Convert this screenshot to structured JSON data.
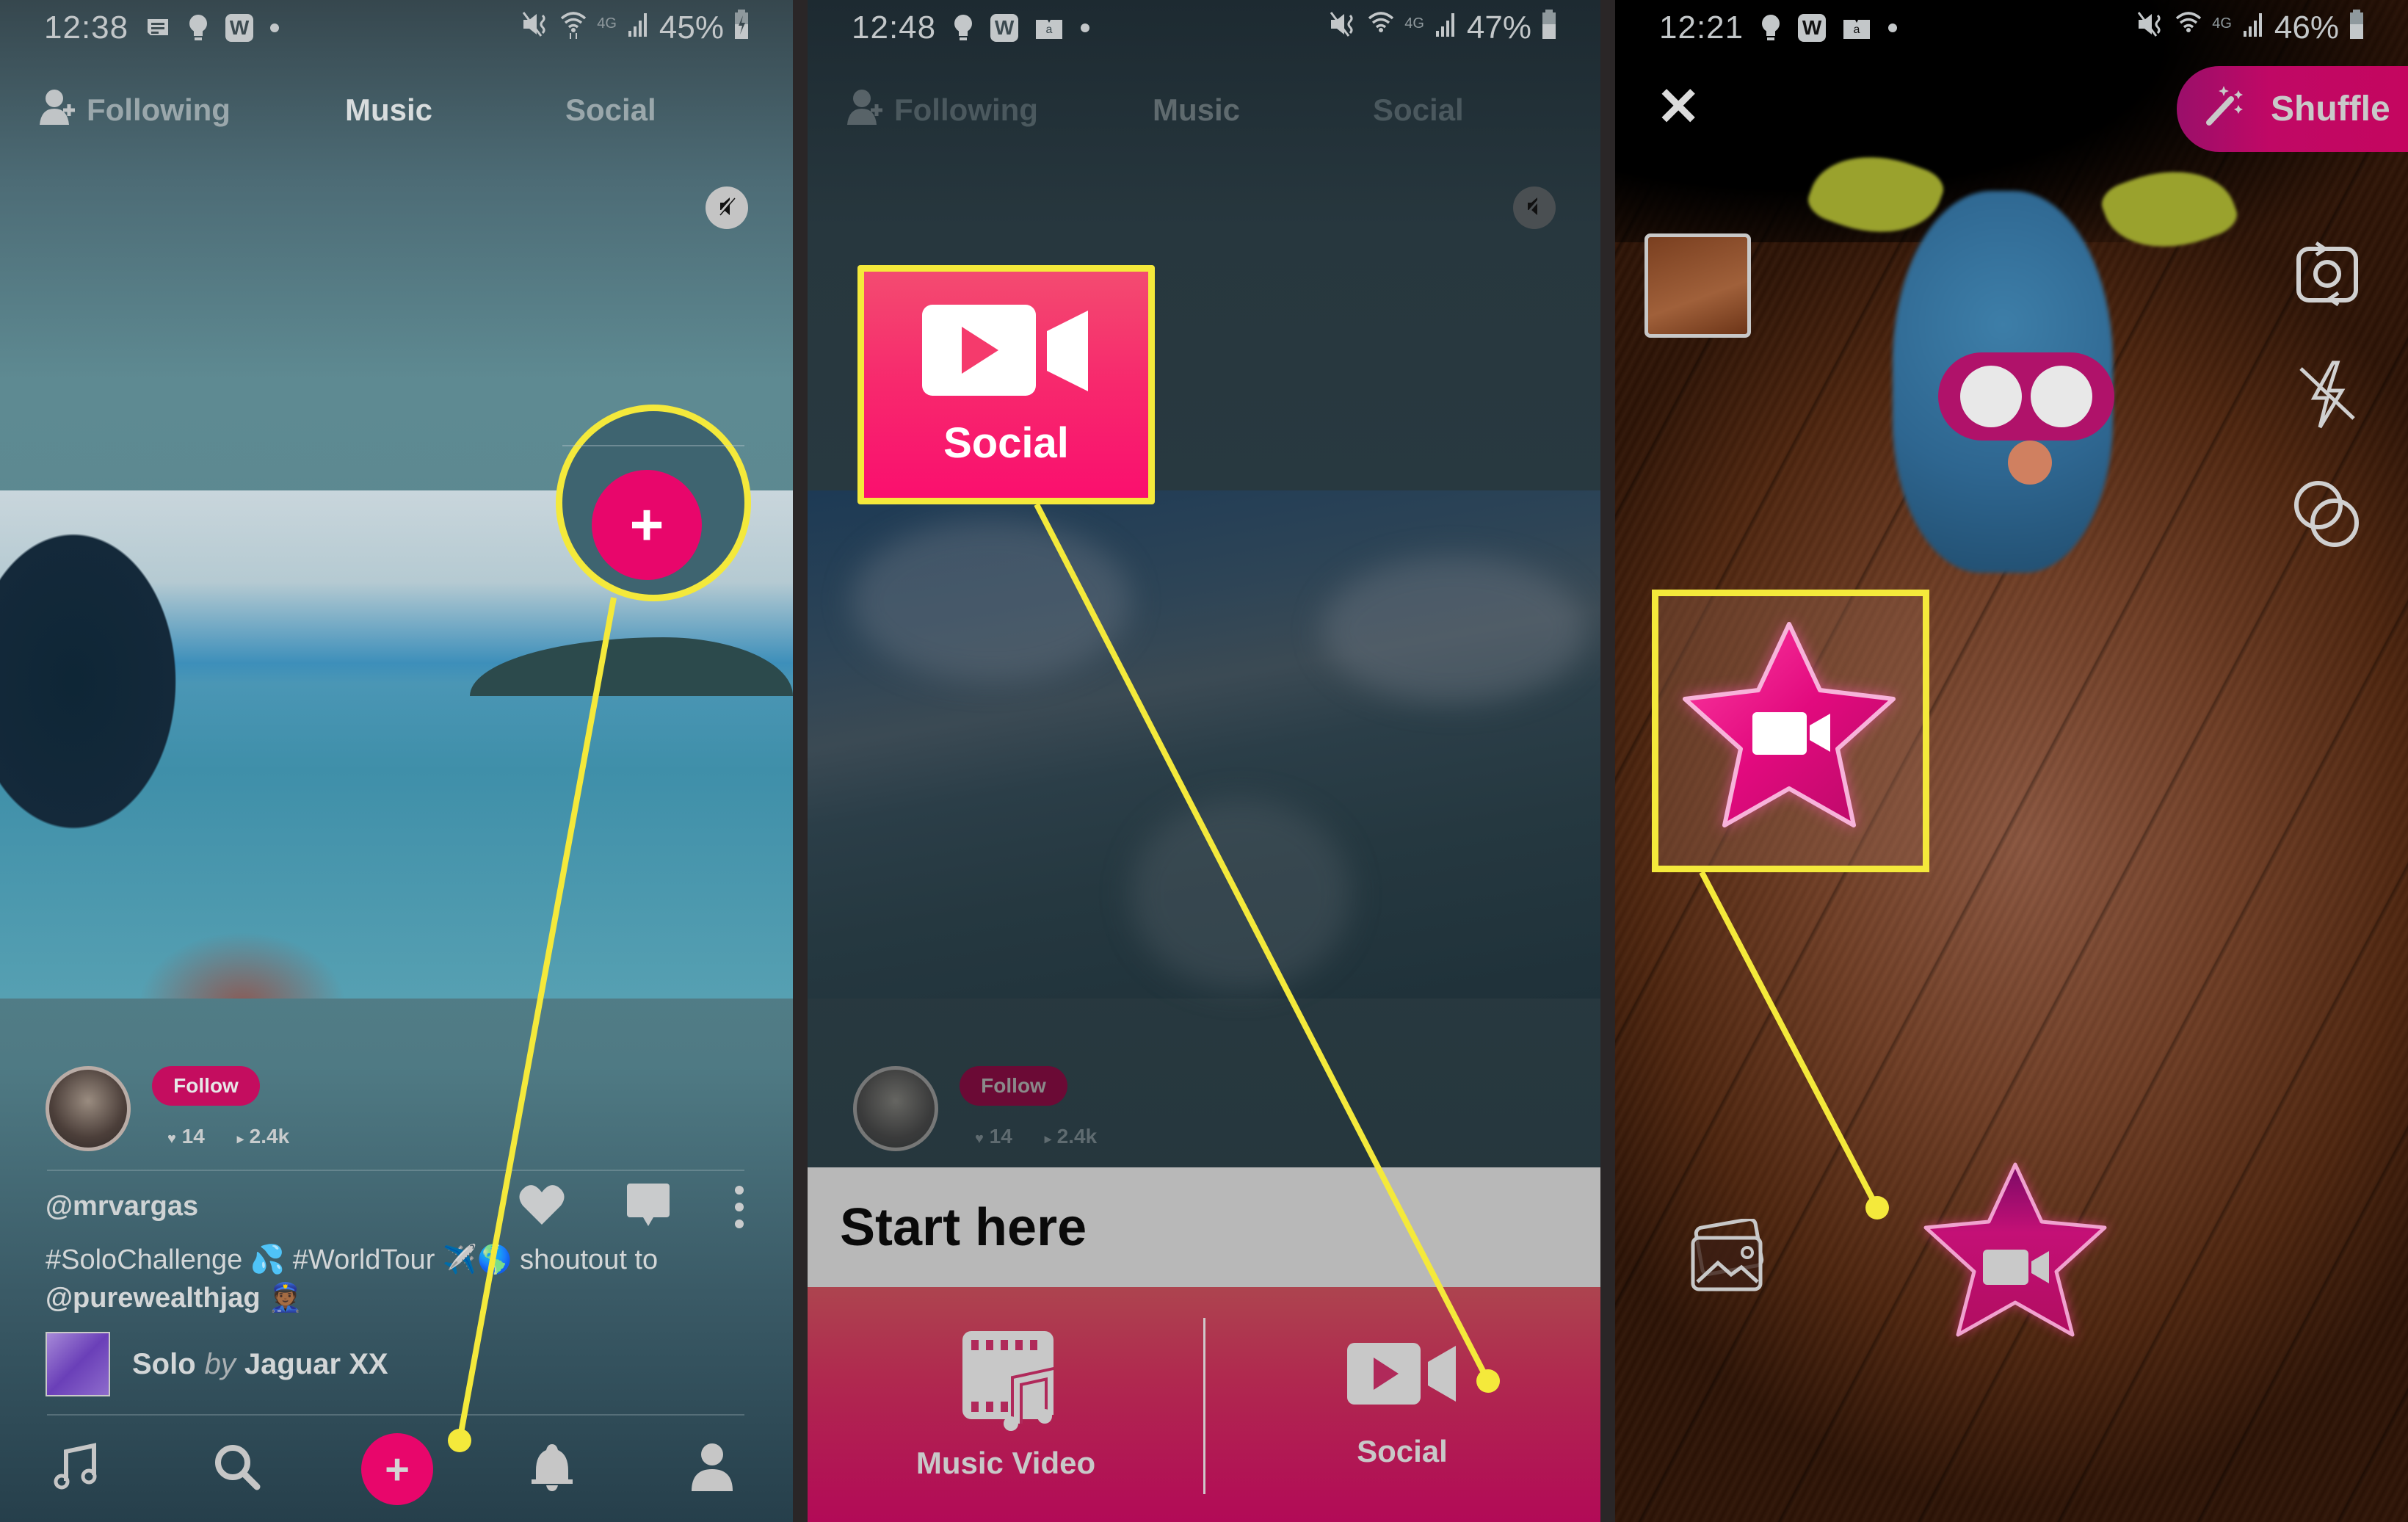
{
  "panels": [
    {
      "status": {
        "time": "12:38",
        "battery": "45%",
        "network": "4G"
      },
      "tabs": [
        "Following",
        "Music",
        "Social"
      ],
      "active_tab": "Music",
      "post": {
        "follow_label": "Follow",
        "likes": "14",
        "plays": "2.4k",
        "username": "@mrvargas",
        "caption_line1": "#SoloChallenge 💦 #WorldTour ✈️🌎 shoutout to",
        "caption_line2": "@purewealthjag 👮🏾",
        "track_title": "Solo",
        "track_by": "by",
        "track_artist": "Jaguar XX"
      },
      "bottom_nav": [
        "music-icon",
        "search-icon",
        "add-icon",
        "notifications-icon",
        "profile-icon"
      ],
      "plus_symbol": "+"
    },
    {
      "status": {
        "time": "12:48",
        "battery": "47%",
        "network": "4G"
      },
      "tabs": [
        "Following",
        "Music",
        "Social"
      ],
      "active_tab": "Music",
      "post": {
        "follow_label": "Follow",
        "likes": "14",
        "plays": "2.4k"
      },
      "callout_label": "Social",
      "start_here": "Start here",
      "options": [
        {
          "label": "Music Video",
          "icon": "film-music-icon"
        },
        {
          "label": "Social",
          "icon": "video-camera-icon"
        }
      ]
    },
    {
      "status": {
        "time": "12:21",
        "battery": "46%",
        "network": "4G"
      },
      "close_symbol": "✕",
      "shuffle_label": "Shuffle",
      "right_tools": [
        "flip-camera-icon",
        "flash-off-icon",
        "effects-icon"
      ]
    }
  ],
  "colors": {
    "accent_pink": "#e8066b",
    "highlight_yellow": "#f4e93b",
    "follow_pink": "#c40d5f"
  }
}
